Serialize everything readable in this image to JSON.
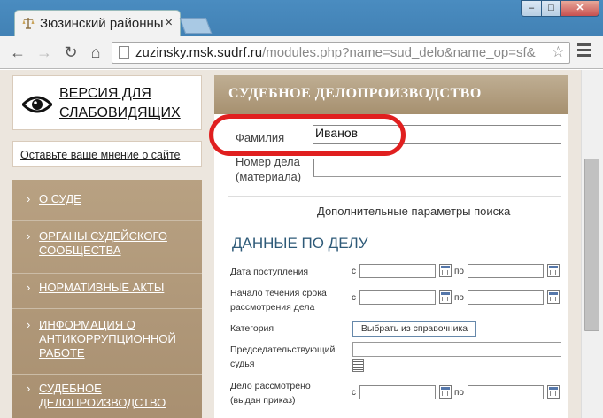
{
  "browser": {
    "tab_title": "Зюзинский районный",
    "tab_close": "×",
    "url_host": "zuzinsky.msk.sudrf.ru",
    "url_rest": "/modules.php?name=sud_delo&name_op=sf&",
    "window_buttons": {
      "minimize": "–",
      "maximize": "□",
      "close": "✕"
    }
  },
  "sidebar": {
    "vision_link": "ВЕРСИЯ ДЛЯ СЛАБОВИДЯЩИХ",
    "feedback_link": "Оставьте ваше мнение о сайте",
    "menu": [
      {
        "label": "О СУДЕ"
      },
      {
        "label": "ОРГАНЫ СУДЕЙСКОГО СООБЩЕСТВА"
      },
      {
        "label": "НОРМАТИВНЫЕ АКТЫ"
      },
      {
        "label": "ИНФОРМАЦИЯ О АНТИКОРРУПЦИОННОЙ РАБОТЕ"
      },
      {
        "label": "СУДЕБНОЕ ДЕЛОПРОИЗВОДСТВО"
      }
    ],
    "chevron": "›"
  },
  "main": {
    "title": "СУДЕБНОЕ ДЕЛОПРОИЗВОДСТВО",
    "surname_label": "Фамилия",
    "surname_value": "Иванов",
    "case_number_label_1": "Номер дела",
    "case_number_label_2": "(материала)",
    "case_number_value": "",
    "more_params": "Дополнительные параметры поиска",
    "case_data_title": "ДАННЫЕ ПО ДЕЛУ",
    "receipt_date_label": "Дата поступления",
    "term_start_label_1": "Начало течения срока",
    "term_start_label_2": "рассмотрения дела",
    "category_label": "Категория",
    "category_button": "Выбрать из справочника",
    "judge_label_1": "Председательствующий",
    "judge_label_2": "судья",
    "considered_label_1": "Дело рассмотрено",
    "considered_label_2": "(выдан приказ)",
    "from": "с",
    "to": "по"
  },
  "colors": {
    "highlight": "#e01f1f",
    "menu_bg": "#b09878",
    "section_title_color": "#2e5a78",
    "chrome_blue": "#3c7fb1"
  },
  "icons": [
    "favicon-scales-icon",
    "back-icon",
    "forward-icon",
    "reload-icon",
    "home-icon",
    "page-icon",
    "star-icon",
    "menu-icon",
    "eye-icon",
    "calendar-icon",
    "list-icon"
  ]
}
